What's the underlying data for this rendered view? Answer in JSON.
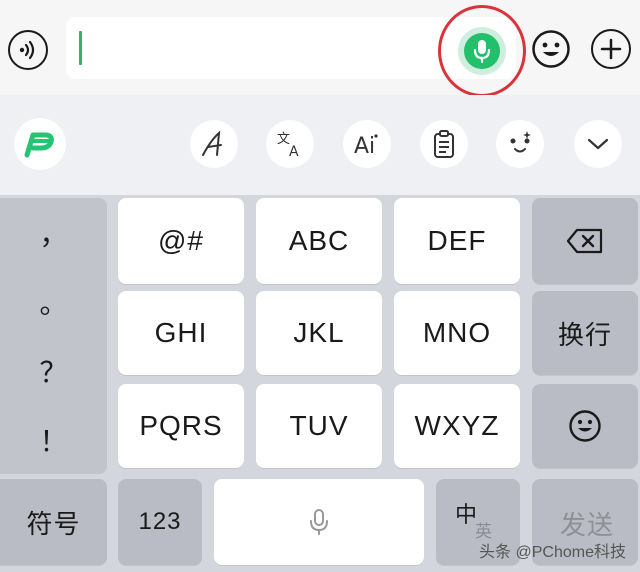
{
  "input_bar": {
    "text_value": "",
    "voice_toggle_icon": "voice-wave-icon",
    "mic_icon": "microphone-icon",
    "emoji_icon": "smiley-icon",
    "plus_icon": "plus-icon",
    "accent_color": "#22c06b",
    "highlight_color": "#d9343a"
  },
  "toolbar": {
    "items": [
      {
        "name": "brand-logo",
        "icon": "p-logo-icon"
      },
      {
        "name": "font-style",
        "icon": "calligraphy-a-icon"
      },
      {
        "name": "translate",
        "icon": "translate-icon"
      },
      {
        "name": "ai-assist",
        "icon": "ai-icon"
      },
      {
        "name": "clipboard",
        "icon": "clipboard-icon"
      },
      {
        "name": "sticker",
        "icon": "face-sticker-icon"
      },
      {
        "name": "collapse",
        "icon": "chevron-down-icon"
      }
    ]
  },
  "keyboard": {
    "punctuation": [
      "，",
      "。",
      "？",
      "！"
    ],
    "keys": {
      "k1": "@#",
      "k2": "ABC",
      "k3": "DEF",
      "k4": "GHI",
      "k5": "JKL",
      "k6": "MNO",
      "k7": "PQRS",
      "k8": "TUV",
      "k9": "WXYZ"
    },
    "newline_label": "换行",
    "symbols_label": "符号",
    "numbers_label": "123",
    "lang_primary": "中",
    "lang_secondary": "英",
    "send_label": "发送"
  },
  "watermark": "头条 @PChome科技"
}
